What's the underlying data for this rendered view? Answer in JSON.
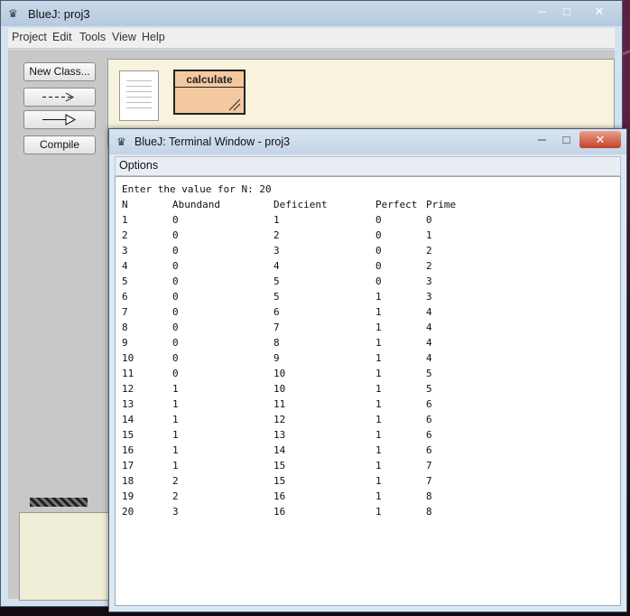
{
  "main_window": {
    "title": "BlueJ:  proj3",
    "menu": [
      "Project",
      "Edit",
      "Tools",
      "View",
      "Help"
    ],
    "buttons": {
      "new_class": "New Class...",
      "compile": "Compile"
    },
    "class_name": "calculate"
  },
  "terminal": {
    "title": "BlueJ: Terminal Window - proj3",
    "menu_options": "Options",
    "prompt": "Enter the value for N: 20",
    "headers": [
      "N",
      "Abundand",
      "Deficient",
      "Perfect",
      "Prime"
    ],
    "rows": [
      [
        "1",
        "0",
        "1",
        "0",
        "0"
      ],
      [
        "2",
        "0",
        "2",
        "0",
        "1"
      ],
      [
        "3",
        "0",
        "3",
        "0",
        "2"
      ],
      [
        "4",
        "0",
        "4",
        "0",
        "2"
      ],
      [
        "5",
        "0",
        "5",
        "0",
        "3"
      ],
      [
        "6",
        "0",
        "5",
        "1",
        "3"
      ],
      [
        "7",
        "0",
        "6",
        "1",
        "4"
      ],
      [
        "8",
        "0",
        "7",
        "1",
        "4"
      ],
      [
        "9",
        "0",
        "8",
        "1",
        "4"
      ],
      [
        "10",
        "0",
        "9",
        "1",
        "4"
      ],
      [
        "11",
        "0",
        "10",
        "1",
        "5"
      ],
      [
        "12",
        "1",
        "10",
        "1",
        "5"
      ],
      [
        "13",
        "1",
        "11",
        "1",
        "6"
      ],
      [
        "14",
        "1",
        "12",
        "1",
        "6"
      ],
      [
        "15",
        "1",
        "13",
        "1",
        "6"
      ],
      [
        "16",
        "1",
        "14",
        "1",
        "6"
      ],
      [
        "17",
        "1",
        "15",
        "1",
        "7"
      ],
      [
        "18",
        "2",
        "15",
        "1",
        "7"
      ],
      [
        "19",
        "2",
        "16",
        "1",
        "8"
      ],
      [
        "20",
        "3",
        "16",
        "1",
        "8"
      ]
    ]
  },
  "icons": {
    "app": "bluej-icon",
    "minimize": "minimize-icon",
    "maximize": "maximize-icon",
    "close": "close-icon"
  }
}
